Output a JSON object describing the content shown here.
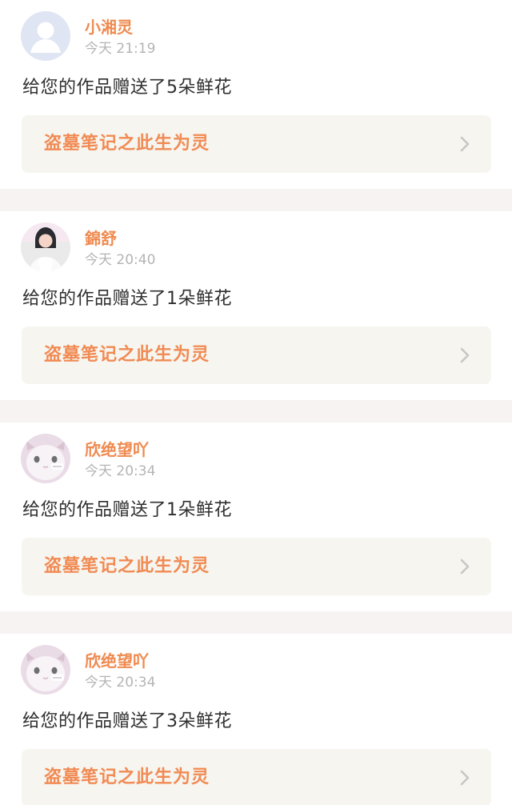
{
  "notifications": [
    {
      "username": "小湘灵",
      "time": "今天 21:19",
      "message": "给您的作品赠送了5朵鲜花",
      "work_title": "盗墓笔记之此生为灵",
      "avatar_icon": "default-user-avatar-icon"
    },
    {
      "username": "錦舒",
      "time": "今天 20:40",
      "message": "给您的作品赠送了1朵鲜花",
      "work_title": "盗墓笔记之此生为灵",
      "avatar_icon": "girl-photo-avatar-icon"
    },
    {
      "username": "欣绝望吖",
      "time": "今天 20:34",
      "message": "给您的作品赠送了1朵鲜花",
      "work_title": "盗墓笔记之此生为灵",
      "avatar_icon": "cat-avatar-icon"
    },
    {
      "username": "欣绝望吖",
      "time": "今天 20:34",
      "message": "给您的作品赠送了3朵鲜花",
      "work_title": "盗墓笔记之此生为灵",
      "avatar_icon": "cat-avatar-icon"
    }
  ],
  "colors": {
    "accent": "#ef8a4f",
    "timestamp": "#b4b4b4",
    "card_background": "#f6f5ef",
    "page_background": "#f6f3f2"
  }
}
